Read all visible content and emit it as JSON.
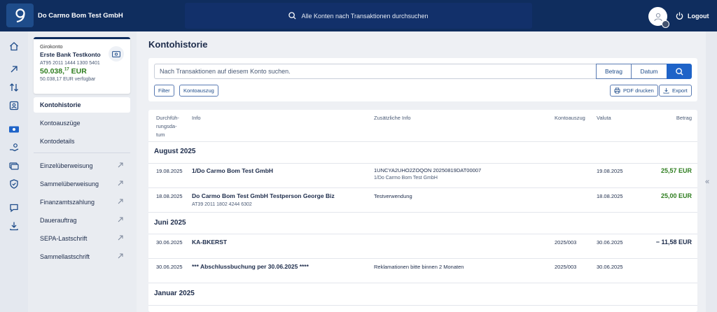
{
  "header": {
    "company": "Do Carmo Bom Test GmbH",
    "search_placeholder": "Alle Konten nach Transaktionen durchsuchen",
    "logout_label": "Logout"
  },
  "account": {
    "type": "Girokonto",
    "name": "Erste Bank Testkonto",
    "iban": "AT95 2011 1444 1300 5401",
    "balance_main": "50.038,",
    "balance_cents": "17",
    "balance_currency": " EUR",
    "available": "50.038,17 EUR verfügbar"
  },
  "sidebar": {
    "items": [
      {
        "label": "Kontohistorie"
      },
      {
        "label": "Kontoauszüge"
      },
      {
        "label": "Kontodetails"
      },
      {
        "label": "Einzelüberweisung"
      },
      {
        "label": "Sammelüberweisung"
      },
      {
        "label": "Finanzamtszahlung"
      },
      {
        "label": "Dauerauftrag"
      },
      {
        "label": "SEPA-Lastschrift"
      },
      {
        "label": "Sammellastschrift"
      }
    ]
  },
  "main": {
    "title": "Kontohistorie",
    "search_placeholder": "Nach Transaktionen auf diesem Konto suchen.",
    "btn_betrag": "Betrag",
    "btn_datum": "Datum",
    "btn_filter": "Filter",
    "btn_kontoauszug": "Kontoauszug",
    "btn_pdf": "PDF drucken",
    "btn_export": "Export"
  },
  "table": {
    "headers": {
      "date": [
        "Durchfüh-",
        "rungsda-",
        "tum"
      ],
      "info": "Info",
      "extra": "Zusätzliche Info",
      "statement": "Kontoauszug",
      "valuta": "Valuta",
      "amount": "Betrag"
    },
    "groups": [
      {
        "label": "August 2025",
        "rows": [
          {
            "date": "19.08.2025",
            "info": "1/Do Carmo Bom Test GmbH",
            "info_sub": "",
            "extra": "1UNCYA2UHO2ZOQON 20250819DAT00007",
            "extra_sub": "1/Do Carmo Bom Test GmbH",
            "statement": "",
            "valuta": "19.08.2025",
            "amount": "25,57 EUR"
          },
          {
            "date": "18.08.2025",
            "info": "Do Carmo Bom Test GmbH Testperson George Biz",
            "info_sub": "AT39 2011 1802 4244 6302",
            "extra": "Testverwendung",
            "extra_sub": "",
            "statement": "",
            "valuta": "18.08.2025",
            "amount": "25,00 EUR"
          }
        ]
      },
      {
        "label": "Juni 2025",
        "rows": [
          {
            "date": "30.06.2025",
            "info": "KA-BKERST",
            "info_sub": "",
            "extra": "",
            "extra_sub": "",
            "statement": "2025/003",
            "valuta": "30.06.2025",
            "amount": "− 11,58 EUR"
          },
          {
            "date": "30.06.2025",
            "info": "*** Abschlussbuchung per 30.06.2025 ****",
            "info_sub": "",
            "extra": "Reklamationen bitte binnen 2 Monaten",
            "extra_sub": "",
            "statement": "2025/003",
            "valuta": "30.06.2025",
            "amount": ""
          }
        ]
      },
      {
        "label": "Januar 2025",
        "rows": []
      }
    ]
  }
}
